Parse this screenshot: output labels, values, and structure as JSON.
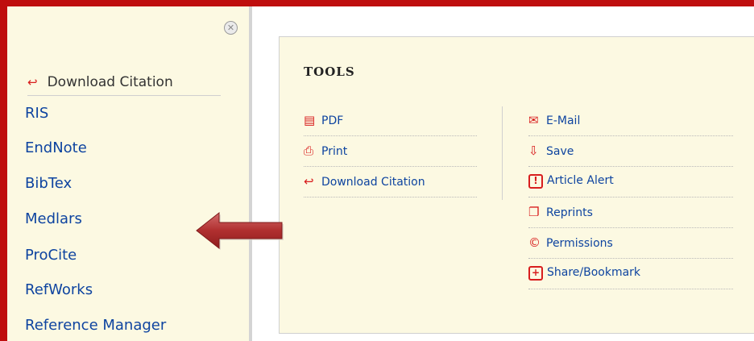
{
  "citation_panel": {
    "header_label": "Download Citation",
    "header_icon": "download-citation-icon",
    "close_icon": "close-circle-icon",
    "items": [
      {
        "label": "RIS"
      },
      {
        "label": "EndNote"
      },
      {
        "label": "BibTex"
      },
      {
        "label": "Medlars"
      },
      {
        "label": "ProCite"
      },
      {
        "label": "RefWorks"
      },
      {
        "label": "Reference Manager"
      }
    ]
  },
  "tools": {
    "title": "TOOLS",
    "left_column": [
      {
        "label": "PDF",
        "icon": "pdf-icon"
      },
      {
        "label": "Print",
        "icon": "print-icon"
      },
      {
        "label": "Download Citation",
        "icon": "download-citation-icon"
      }
    ],
    "right_column": [
      {
        "label": "E-Mail",
        "icon": "email-icon"
      },
      {
        "label": "Save",
        "icon": "save-icon"
      },
      {
        "label": "Article Alert",
        "icon": "alert-icon"
      },
      {
        "label": "Reprints",
        "icon": "reprints-icon"
      },
      {
        "label": "Permissions",
        "icon": "copyright-icon"
      },
      {
        "label": "Share/Bookmark",
        "icon": "share-plus-icon"
      }
    ]
  },
  "annotation": {
    "arrow_icon": "left-arrow-icon"
  },
  "colors": {
    "frame_red": "#bf0e0e",
    "panel_bg": "#fcf9e2",
    "link_blue": "#0e44a0",
    "icon_red": "#d81d1d"
  }
}
